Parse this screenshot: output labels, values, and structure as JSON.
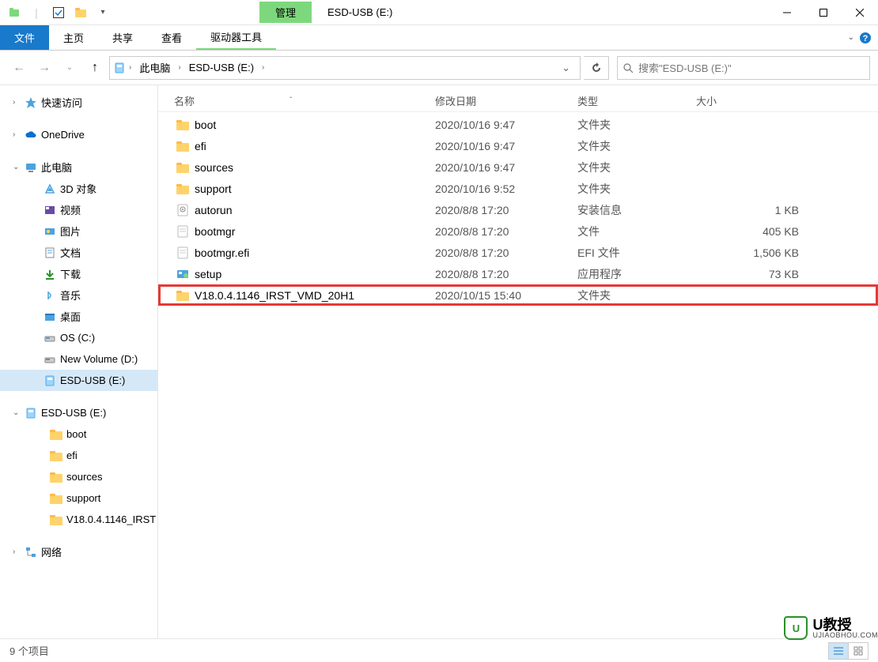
{
  "window": {
    "title": "ESD-USB (E:)",
    "context_tab_label": "管理"
  },
  "ribbon": {
    "file": "文件",
    "tabs": [
      "主页",
      "共享",
      "查看"
    ],
    "context": "驱动器工具"
  },
  "breadcrumbs": [
    "此电脑",
    "ESD-USB (E:)"
  ],
  "search_placeholder": "搜索\"ESD-USB (E:)\"",
  "columns": {
    "name": "名称",
    "date": "修改日期",
    "type": "类型",
    "size": "大小"
  },
  "sidebar": {
    "quick_access": "快速访问",
    "onedrive": "OneDrive",
    "this_pc": "此电脑",
    "pc_items": [
      "3D 对象",
      "视频",
      "图片",
      "文档",
      "下载",
      "音乐",
      "桌面",
      "OS (C:)",
      "New Volume (D:)",
      "ESD-USB (E:)"
    ],
    "drive": "ESD-USB (E:)",
    "drive_items": [
      "boot",
      "efi",
      "sources",
      "support",
      "V18.0.4.1146_IRST"
    ],
    "network": "网络"
  },
  "files": [
    {
      "icon": "folder",
      "name": "boot",
      "date": "2020/10/16 9:47",
      "type": "文件夹",
      "size": ""
    },
    {
      "icon": "folder",
      "name": "efi",
      "date": "2020/10/16 9:47",
      "type": "文件夹",
      "size": ""
    },
    {
      "icon": "folder",
      "name": "sources",
      "date": "2020/10/16 9:47",
      "type": "文件夹",
      "size": ""
    },
    {
      "icon": "folder",
      "name": "support",
      "date": "2020/10/16 9:52",
      "type": "文件夹",
      "size": ""
    },
    {
      "icon": "inf",
      "name": "autorun",
      "date": "2020/8/8 17:20",
      "type": "安装信息",
      "size": "1 KB"
    },
    {
      "icon": "file",
      "name": "bootmgr",
      "date": "2020/8/8 17:20",
      "type": "文件",
      "size": "405 KB"
    },
    {
      "icon": "file",
      "name": "bootmgr.efi",
      "date": "2020/8/8 17:20",
      "type": "EFI 文件",
      "size": "1,506 KB"
    },
    {
      "icon": "exe",
      "name": "setup",
      "date": "2020/8/8 17:20",
      "type": "应用程序",
      "size": "73 KB"
    },
    {
      "icon": "folder",
      "name": "V18.0.4.1146_IRST_VMD_20H1",
      "date": "2020/10/15 15:40",
      "type": "文件夹",
      "size": "",
      "highlighted": true
    }
  ],
  "status": "9 个项目",
  "watermark": {
    "brand": "U教授",
    "sub": "UJIAOBHOU.COM"
  }
}
